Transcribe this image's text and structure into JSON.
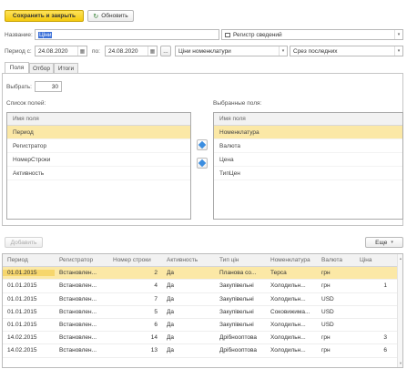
{
  "toolbar": {
    "save_close_label": "Сохранить и закрыть",
    "refresh_label": "Обновить"
  },
  "form": {
    "name_label": "Название:",
    "name_value": "Ціни",
    "register_value": "Регистр сведений",
    "period_label": "Период с:",
    "date_from": "24.08.2020",
    "to_label": "по:",
    "date_to": "24.08.2020",
    "table_select": "Ціни номенклатури",
    "slice_select": "Срез последних"
  },
  "tabs": [
    {
      "label": "Поля"
    },
    {
      "label": "Отбор"
    },
    {
      "label": "Итоги"
    }
  ],
  "select_count": {
    "label": "Выбрать:",
    "value": "30"
  },
  "fields_list": {
    "title": "Список полей:",
    "header": "Имя поля",
    "items": [
      "Период",
      "Регистратор",
      "НомерСтроки",
      "Активность"
    ]
  },
  "selected_list": {
    "title": "Выбранные поля:",
    "header": "Имя поля",
    "items": [
      "Номенклатура",
      "Валюта",
      "Цена",
      "ТипЦен"
    ]
  },
  "actions": {
    "add_label": "Добавить",
    "more_label": "Еще"
  },
  "results": {
    "columns": [
      "Период",
      "Регистратор",
      "Номер строки",
      "Активность",
      "Тип цін",
      "Номенклатура",
      "Валюта",
      "Ціна"
    ],
    "rows": [
      [
        "01.01.2015",
        "Встановлен...",
        "2",
        "Да",
        "Планова со...",
        "Терса",
        "грн",
        ""
      ],
      [
        "01.01.2015",
        "Встановлен...",
        "4",
        "Да",
        "Закупівельні",
        "Холодильн...",
        "грн",
        "1"
      ],
      [
        "01.01.2015",
        "Встановлен...",
        "7",
        "Да",
        "Закупівельні",
        "Холодильн...",
        "USD",
        ""
      ],
      [
        "01.01.2015",
        "Встановлен...",
        "5",
        "Да",
        "Закупівельні",
        "Соковижима...",
        "USD",
        ""
      ],
      [
        "01.01.2015",
        "Встановлен...",
        "6",
        "Да",
        "Закупівельні",
        "Холодильн...",
        "USD",
        ""
      ],
      [
        "14.02.2015",
        "Встановлен...",
        "14",
        "Да",
        "Дрібнооптова",
        "Холодильн...",
        "грн",
        "3"
      ],
      [
        "14.02.2015",
        "Встановлен...",
        "13",
        "Да",
        "Дрібнооптова",
        "Холодильн...",
        "грн",
        "6"
      ]
    ]
  }
}
